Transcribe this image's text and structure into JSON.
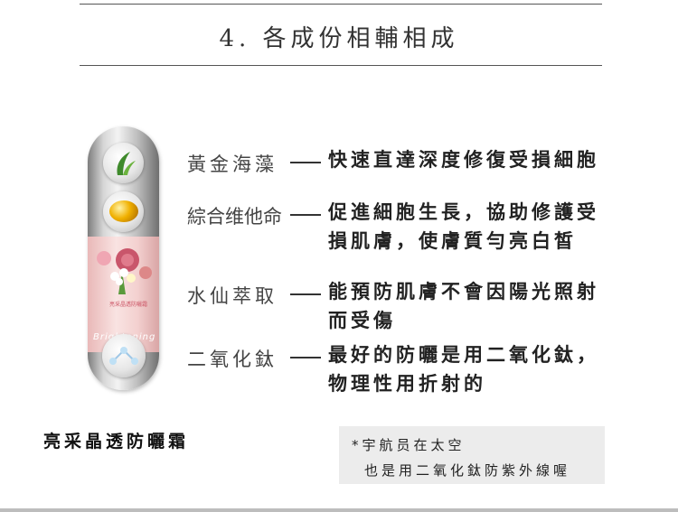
{
  "header": {
    "title": "4. 各成份相輔相成"
  },
  "bottle": {
    "label_line": "亮采晶透防曬霜",
    "brand": "Brightening"
  },
  "ingredients": [
    {
      "name": "黃金海藻",
      "lines": [
        "快速直達深度修復受損細胞"
      ]
    },
    {
      "name": "綜合维他命",
      "lines": [
        "促進細胞生長，協助修護受",
        "損肌膚，使膚質勻亮白皙"
      ]
    },
    {
      "name": "水仙萃取",
      "lines": [
        "能預防肌膚不會因陽光照射",
        "而受傷"
      ]
    },
    {
      "name": "二氧化鈦",
      "lines": [
        "最好的防曬是用二氧化鈦，",
        "物理性用折射的"
      ]
    }
  ],
  "product": {
    "name": "亮采晶透防曬霜"
  },
  "note": {
    "line1": "*宇航员在太空",
    "line2": "也是用二氧化鈦防紫外線喔"
  },
  "colors": {
    "note_bg": "#ececec",
    "label_pink": "#f3d0cf",
    "rule": "#555555"
  }
}
